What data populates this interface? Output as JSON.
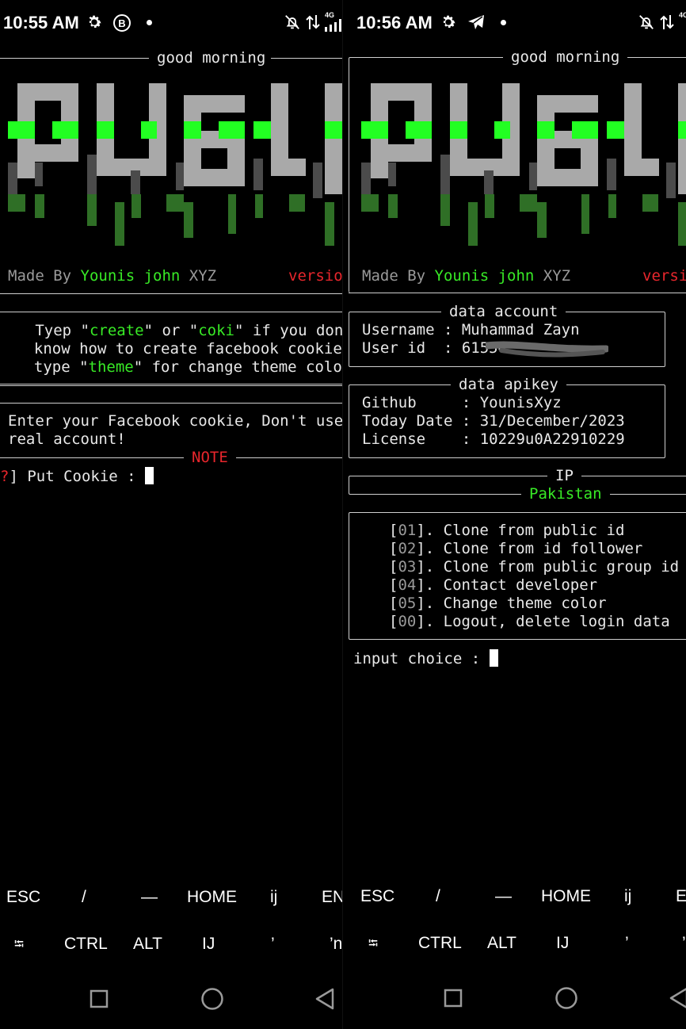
{
  "left": {
    "status": {
      "time": "10:55 AM",
      "network": "4G"
    },
    "greeting": "good morning",
    "credit": {
      "prefix": "Made By ",
      "author": "Younis john",
      "suffix": " XYZ",
      "version": "versio"
    },
    "help": {
      "line1": {
        "a": "   Tyep \"",
        "b": "create",
        "c": "\" or \"",
        "d": "coki",
        "e": "\" if you don"
      },
      "line2": "  know how to create facebook cookie",
      "line3": {
        "a": "  type \"",
        "b": "theme",
        "c": "\" for change theme color"
      }
    },
    "note_text": {
      "line1": "Enter your Facebook cookie, Don't use",
      "line2": "real account!"
    },
    "note_label": "NOTE",
    "prompt": {
      "mark": "?",
      "rest": "] Put Cookie : "
    },
    "keys_row1": [
      "ESC",
      "/",
      "—",
      "HOME",
      "ij",
      "EN"
    ],
    "keys_row2": [
      "⭾",
      "CTRL",
      "ALT",
      "IJ",
      "’",
      "’n"
    ]
  },
  "right": {
    "status": {
      "time": "10:56 AM",
      "network": "4G"
    },
    "greeting": "good morning",
    "credit": {
      "prefix": "Made By ",
      "author": "Younis john",
      "suffix": " XYZ",
      "version": "versi"
    },
    "account": {
      "title": "data account",
      "username_label": "Username : ",
      "username": "Muhammad Zayn",
      "userid_label": "User id  : ",
      "userid": "61554"
    },
    "apikey": {
      "title": "data apikey",
      "github": "Github     : YounisXyz",
      "date": "Today Date : 31/December/2023",
      "license": "License    : 10229u0A22910229"
    },
    "ip": {
      "title": "IP",
      "country": "Pakistan"
    },
    "menu": [
      {
        "num": "01",
        "label": "]. Clone from public id"
      },
      {
        "num": "02",
        "label": "]. Clone from id follower"
      },
      {
        "num": "03",
        "label": "]. Clone from public group id"
      },
      {
        "num": "04",
        "label": "]. Contact developer"
      },
      {
        "num": "05",
        "label": "]. Change theme color"
      },
      {
        "num": "00",
        "label": "]. Logout, delete login data"
      }
    ],
    "prompt": "input choice : ",
    "keys_row1": [
      "ESC",
      "/",
      "—",
      "HOME",
      "ij",
      "E"
    ],
    "keys_row2": [
      "⭾",
      "CTRL",
      "ALT",
      "IJ",
      "’",
      "’"
    ]
  },
  "colors": {
    "accent_green": "#38ea26",
    "alert_red": "#e8262c",
    "terminal_bg": "#000000"
  },
  "icons": [
    "settings-icon",
    "b-badge-icon",
    "telegram-icon",
    "dot-icon",
    "bell-off-icon",
    "data-arrows-icon",
    "signal-icon",
    "recents-icon",
    "home-icon",
    "back-icon"
  ]
}
